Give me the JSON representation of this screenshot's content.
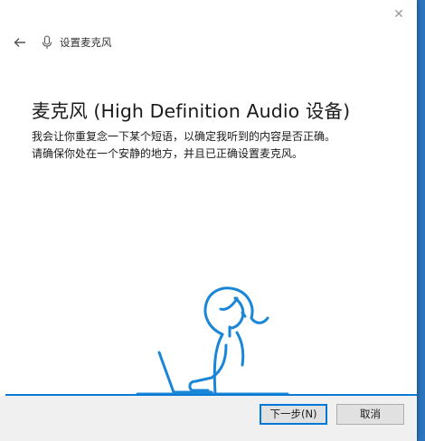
{
  "window": {
    "title": "设置麦克风",
    "close_glyph": "✕"
  },
  "main": {
    "heading": "麦克风 (High Definition Audio 设备)",
    "description_line1": "我会让你重复念一下某个短语，以确定我听到的内容是否正确。",
    "description_line2": "请确保你处在一个安静的地方，并且已正确设置麦克风。"
  },
  "footer": {
    "next_label": "下一步(N)",
    "cancel_label": "取消"
  },
  "colors": {
    "accent": "#0a7ad6",
    "illustration": "#1a86d8"
  },
  "icons": [
    "back-arrow-icon",
    "microphone-icon",
    "close-icon"
  ]
}
